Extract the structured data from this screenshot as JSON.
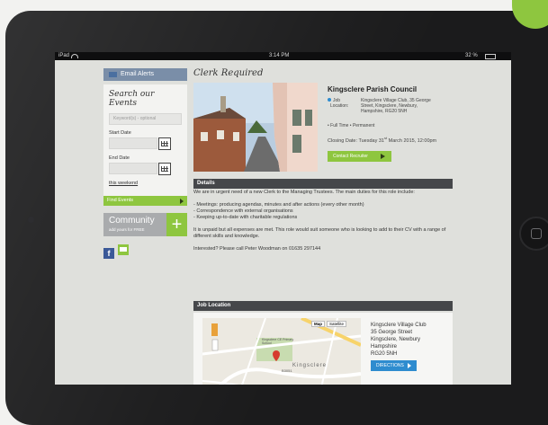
{
  "status_bar": {
    "carrier": "iPad",
    "time": "3:14 PM",
    "battery": "32 %"
  },
  "sidebar": {
    "email_alerts": "Email Alerts",
    "search_title": "Search our Events",
    "keyword_placeholder": "Keyword(s) - optional",
    "start_date_label": "Start Date",
    "end_date_label": "End Date",
    "this_weekend": "this weekend",
    "find_events": "Find Events",
    "community_title": "Community",
    "community_sub": "add yours for FREE",
    "facebook": "f"
  },
  "job": {
    "title": "Clerk Required",
    "employer": "Kingsclere Parish Council",
    "location_label_1": "Job",
    "location_label_2": "Location:",
    "location_lines": [
      "Kingsclere Village Club, 35 George",
      "Street, Kingsclere, Newbury,",
      "Hampshire, RG20 5NH"
    ],
    "terms": "• Full Time  • Permanent",
    "closing_prefix": "Closing Date: Tuesday 31",
    "closing_sup": "st",
    "closing_suffix": " March 2015, 12:00pm",
    "contact_button": "Contact Recruiter"
  },
  "details": {
    "heading": "Details",
    "p1": "We are in urgent need of a new Clerk to the Managing Trustees. The main duties for this role include:",
    "bullets": [
      "- Meetings: producing agendas, minutes and after actions (every other month)",
      "- Correspondence with external organisations",
      "- Keeping up-to-date with charitable regulations"
    ],
    "p2": "It is unpaid but all expenses are met. This role would suit someone who is looking to add to their CV with a range of different skills and knowledge.",
    "p3": "Interested? Please call Peter Woodman on 01635 297144"
  },
  "location": {
    "heading": "Job Location",
    "address": [
      "Kingsclere Village Club",
      "35 George Street",
      "Kingsclere, Newbury",
      "Hampshire",
      "RG20 5NH"
    ],
    "directions": "DIRECTIONS",
    "map_type_map": "Map",
    "map_type_sat": "Satellite",
    "map_labels": {
      "place": "Kingsclere",
      "school": "Kingsclere CE Primary School",
      "road": "B3051"
    }
  },
  "colors": {
    "accent_green": "#8ec63f",
    "header_dark": "#45474a",
    "link_blue": "#2e8ccf",
    "alert_blue": "#7a8ea8"
  }
}
